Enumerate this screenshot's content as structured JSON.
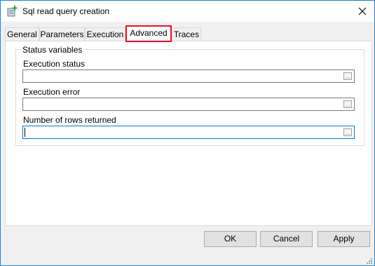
{
  "window": {
    "title": "Sql read query creation"
  },
  "tabs": [
    {
      "label": "General"
    },
    {
      "label": "Parameters"
    },
    {
      "label": "Execution"
    },
    {
      "label": "Advanced",
      "selected": true
    },
    {
      "label": "Traces"
    }
  ],
  "group": {
    "legend": "Status variables",
    "fields": [
      {
        "label": "Execution status",
        "value": "",
        "button_label": "..."
      },
      {
        "label": "Execution error",
        "value": "",
        "button_label": "..."
      },
      {
        "label": "Number of rows returned",
        "value": "",
        "button_label": "...",
        "focused": true
      }
    ]
  },
  "buttons": {
    "ok": "OK",
    "cancel": "Cancel",
    "apply": "Apply"
  },
  "colors": {
    "highlight": "#e81123",
    "focus": "#0078d7",
    "titlebar": "#ffffff",
    "dialog": "#f0f0f0"
  }
}
